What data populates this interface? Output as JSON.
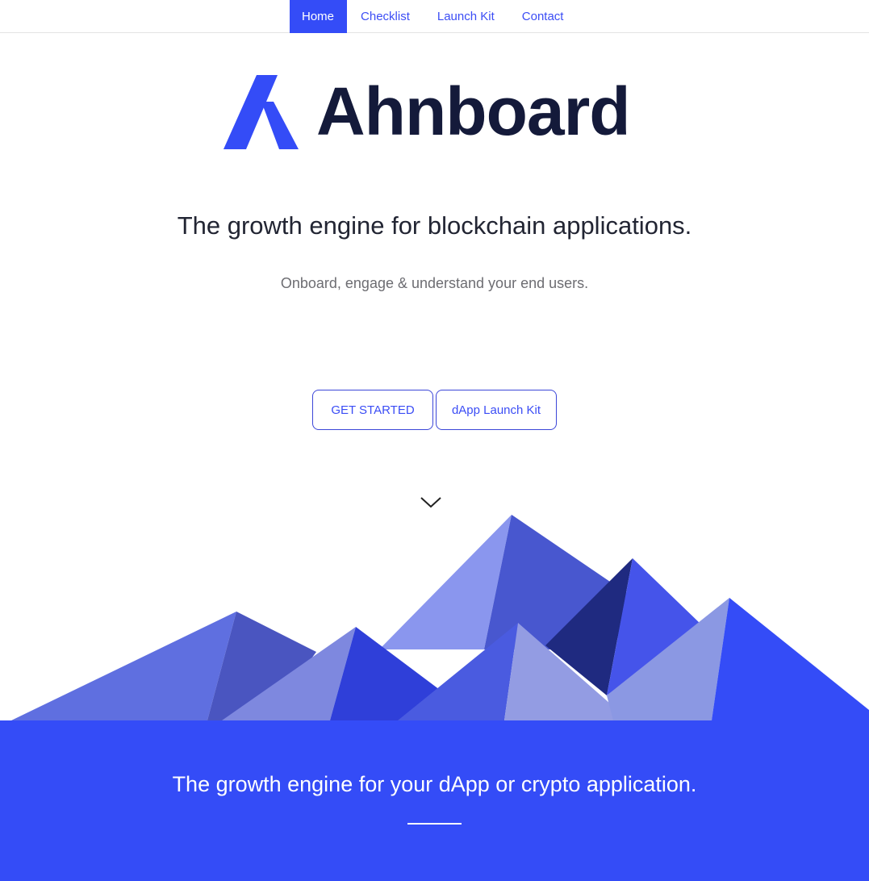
{
  "nav": {
    "items": [
      {
        "label": "Home",
        "active": true
      },
      {
        "label": "Checklist",
        "active": false
      },
      {
        "label": "Launch Kit",
        "active": false
      },
      {
        "label": "Contact",
        "active": false
      }
    ]
  },
  "logo": {
    "wordmark": "Ahnboard",
    "mark_icon": "ahnboard-a-logo-icon"
  },
  "hero": {
    "title": "The growth engine for blockchain applications.",
    "subtitle": "Onboard, engage & understand your end users.",
    "buttons": {
      "get_started": "GET STARTED",
      "launch_kit": "dApp Launch Kit"
    },
    "scroll_icon": "chevron-down-icon"
  },
  "band": {
    "title": "The growth engine for your dApp or crypto application."
  },
  "colors": {
    "brand": "#344CF7",
    "dark_text": "#141A3A",
    "mountain_palette": [
      "#5F6FE0",
      "#4A55C0",
      "#8A96EE",
      "#4857CF",
      "#7E88DF",
      "#2F3FD9",
      "#1F2A80",
      "#4554EA",
      "#9099E6",
      "#8B98E3",
      "#344CF7"
    ]
  }
}
